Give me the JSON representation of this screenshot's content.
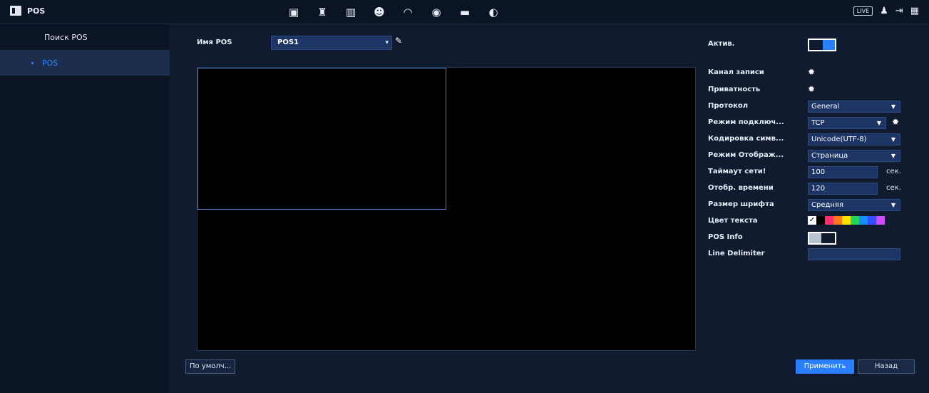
{
  "topbar": {
    "title": "POS",
    "icons": [
      "camera-icon",
      "alarm-icon",
      "pos-icon",
      "ai-icon",
      "gauge-icon",
      "record-icon",
      "monitor-icon",
      "audio-icon"
    ],
    "live_label": "LIVE",
    "right_icons": [
      "user-icon",
      "logout-icon",
      "grid-icon"
    ]
  },
  "sidebar": {
    "items": [
      {
        "label": "Поиск POS",
        "active": false
      },
      {
        "label": "POS",
        "active": true
      }
    ]
  },
  "main": {
    "name_label": "Имя POS",
    "name_value": "POS1",
    "buttons": {
      "default": "По умолч...",
      "apply": "Применить",
      "back": "Назад"
    }
  },
  "settings": {
    "active_label": "Актив.",
    "active": true,
    "record_channel_label": "Канал записи",
    "privacy_label": "Приватность",
    "protocol_label": "Протокол",
    "protocol_value": "General",
    "connection_label": "Режим подключ...",
    "connection_value": "TCP",
    "encoding_label": "Кодировка симв...",
    "encoding_value": "Unicode(UTF-8)",
    "display_mode_label": "Режим Отображ...",
    "display_mode_value": "Страница",
    "timeout_label": "Таймаут сети!",
    "timeout_value": "100",
    "timeout_unit": "сек.",
    "display_time_label": "Отобр. времени",
    "display_time_value": "120",
    "display_time_unit": "сек.",
    "font_size_label": "Размер шрифта",
    "font_size_value": "Средняя",
    "text_color_label": "Цвет текста",
    "text_colors": [
      "#ffffff",
      "#000000",
      "#ff2e6e",
      "#ff7a1a",
      "#ffe100",
      "#22d65a",
      "#1a8cff",
      "#3a4cff",
      "#d04cff"
    ],
    "pos_info_label": "POS Info",
    "pos_info": false,
    "line_delimiter_label": "Line Delimiter",
    "line_delimiter_value": ""
  }
}
